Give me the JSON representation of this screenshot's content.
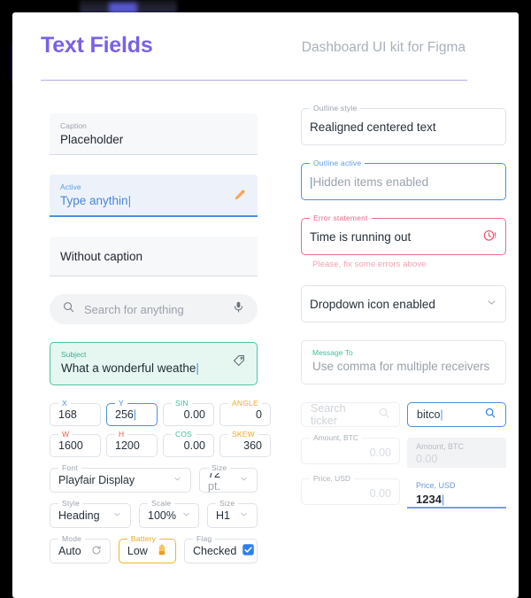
{
  "header": {
    "title": "Text Fields",
    "subtitle": "Dashboard UI kit for Figma"
  },
  "left": {
    "caption_field": {
      "label": "Caption",
      "value": "Placeholder"
    },
    "active_field": {
      "label": "Active",
      "value": "Type anythin",
      "caret": "|",
      "icon": "pencil-icon"
    },
    "without_caption": {
      "value": "Without caption"
    },
    "search_field": {
      "placeholder": "Search for anything",
      "leading_icon": "search-icon",
      "trailing_icon": "microphone-icon"
    },
    "subject_field": {
      "label": "Subject",
      "value": "What a wonderful weathe",
      "caret": "|",
      "icon": "tag-icon"
    },
    "numbers": [
      {
        "label": "X",
        "value": "168",
        "color": "#4a90e2",
        "align": "left",
        "focused": false
      },
      {
        "label": "Y",
        "value": "256",
        "color": "#4a90e2",
        "align": "left",
        "focused": true,
        "caret": "|"
      },
      {
        "label": "SIN",
        "value": "0.00",
        "color": "#3fbf9b",
        "align": "right",
        "focused": false
      },
      {
        "label": "ANGLE",
        "value": "0",
        "color": "#f0a92a",
        "align": "right",
        "focused": false
      },
      {
        "label": "W",
        "value": "1600",
        "color": "#e8604c",
        "align": "left",
        "focused": false
      },
      {
        "label": "H",
        "value": "1200",
        "color": "#e8604c",
        "align": "left",
        "focused": false
      },
      {
        "label": "COS",
        "value": "0.00",
        "color": "#3fbf9b",
        "align": "right",
        "focused": false
      },
      {
        "label": "SKEW",
        "value": "360",
        "color": "#f0a92a",
        "align": "right",
        "focused": false
      }
    ],
    "font_select": {
      "label": "Font",
      "value": "Playfair Display",
      "icon": "chevron-down-icon"
    },
    "fontsize_select": {
      "label": "Size",
      "value": "72",
      "unit": "pt.",
      "icon": "chevron-down-icon"
    },
    "style_select": {
      "label": "Style",
      "value": "Heading",
      "icon": "chevron-down-icon"
    },
    "scale_select": {
      "label": "Scale",
      "value": "100%",
      "icon": "chevron-down-icon"
    },
    "size_select": {
      "label": "Size",
      "value": "H1",
      "icon": "chevron-down-icon"
    },
    "mode_field": {
      "label": "Mode",
      "value": "Auto",
      "icon": "sync-icon"
    },
    "battery_field": {
      "label": "Battery",
      "value": "Low",
      "icon": "battery-low-icon"
    },
    "flag_field": {
      "label": "Flag",
      "value": "Checked",
      "icon": "checkbox-checked-icon"
    }
  },
  "right": {
    "outline_style": {
      "label": "Outline style",
      "value": "Realigned centered text"
    },
    "outline_active": {
      "label": "Outline active",
      "caret": "|",
      "value": "Hidden items enabled"
    },
    "error_field": {
      "label": "Error statement",
      "value": "Time is running out",
      "icon": "clock-alert-icon",
      "helper": "Please, fix some errors above"
    },
    "dropdown_field": {
      "value": "Dropdown icon enabled",
      "icon": "chevron-down-icon"
    },
    "message_field": {
      "label": "Message To",
      "value": "Use comma for multiple receivers"
    },
    "ticker_disabled": {
      "placeholder": "Search ticker",
      "icon": "search-icon"
    },
    "ticker_active": {
      "value": "bitco",
      "caret": "|",
      "icon": "search-icon"
    },
    "amount_outline": {
      "label": "Amount, BTC",
      "value": "0.00"
    },
    "amount_filled": {
      "label": "Amount, BTC",
      "value": "0.00"
    },
    "price_outline": {
      "label": "Price, USD",
      "value": "0.00"
    },
    "price_filled": {
      "label": "Price, USD",
      "value": "1234",
      "caret": "|"
    }
  },
  "colors": {
    "accent_purple": "#7b61e4",
    "accent_blue": "#4a90e2",
    "accent_green": "#3fbf9b",
    "accent_amber": "#f0a92a",
    "accent_red": "#e8604c",
    "accent_pink": "#ef6a8a"
  }
}
